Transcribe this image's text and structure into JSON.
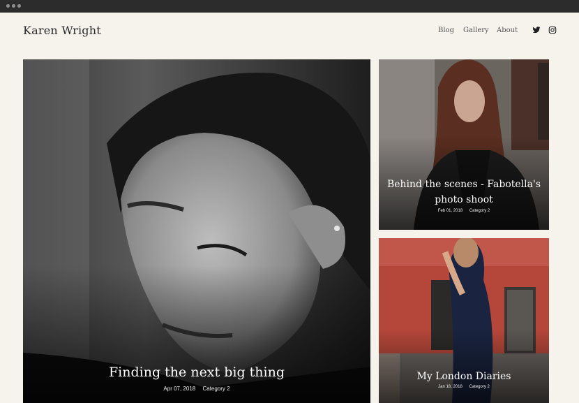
{
  "site": {
    "brand": "Karen Wright"
  },
  "nav": {
    "items": [
      "Blog",
      "Gallery",
      "About"
    ],
    "social": [
      "twitter-icon",
      "instagram-icon"
    ]
  },
  "posts": [
    {
      "title": "Finding the next big thing",
      "date": "Apr 07, 2018",
      "category": "Category 2"
    },
    {
      "title": "Behind the scenes - Fabotella's photo shoot",
      "date": "Feb 01, 2018",
      "category": "Category 2"
    },
    {
      "title": "My London Diaries",
      "date": "Jan 18, 2018",
      "category": "Category 2"
    }
  ],
  "colors": {
    "background": "#f6f2ec",
    "window_bar": "#2c2c2c",
    "text": "#2b2b2b"
  }
}
